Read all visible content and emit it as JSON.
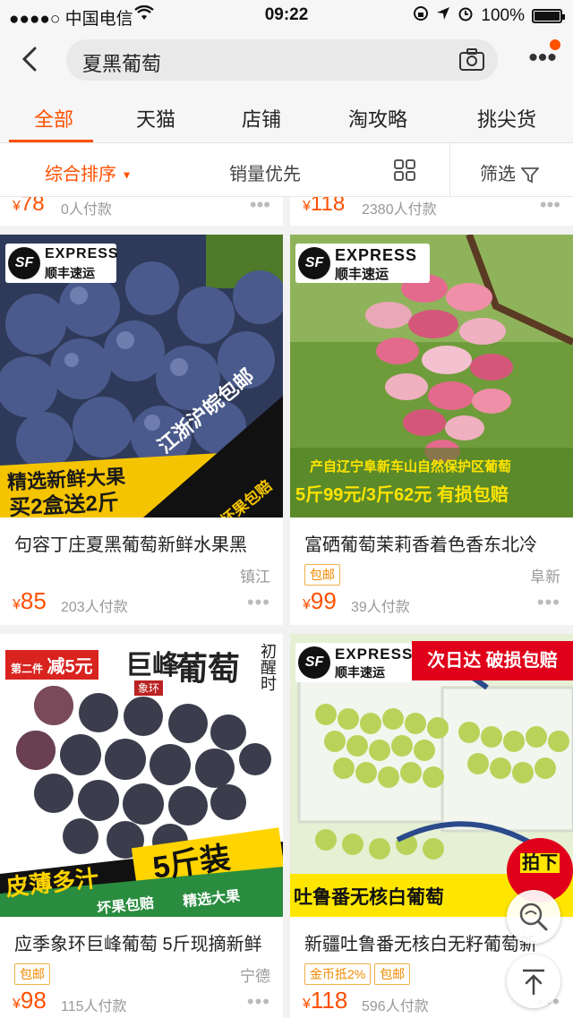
{
  "status": {
    "carrier": "●●●●○ 中国电信",
    "time": "09:22",
    "battery": "100%"
  },
  "search": {
    "query": "夏黑葡萄"
  },
  "tabs": [
    "全部",
    "天猫",
    "店铺",
    "淘攻略",
    "挑尖货"
  ],
  "sort": {
    "comprehensive": "综合排序",
    "sales": "销量优先",
    "filter": "筛选"
  },
  "top_row": [
    {
      "price": "78",
      "paid": "0人付款"
    },
    {
      "price": "118",
      "paid": "2380人付款"
    }
  ],
  "products": [
    {
      "title": "句容丁庄夏黑葡萄新鲜水果黑",
      "location": "镇江",
      "tags": [],
      "price": "85",
      "paid": "203人付款",
      "img_text": {
        "promo1": "精选新鲜大果",
        "promo2": "买2盒送2斤",
        "ribbon": "江浙沪皖包邮",
        "sub": "坏果包赔"
      }
    },
    {
      "title": "富硒葡萄茉莉香着色香东北冷",
      "location": "阜新",
      "tags": [
        "包邮"
      ],
      "price": "99",
      "paid": "39人付款",
      "img_text": {
        "line1": "产自辽宁阜新车山自然保护区葡萄",
        "line2": "5斤99元/3斤62元 有损包赔"
      }
    },
    {
      "title": "应季象环巨峰葡萄 5斤现摘新鲜",
      "location": "宁德",
      "tags": [
        "包邮"
      ],
      "price": "98",
      "paid": "115人付款",
      "img_text": {
        "badge_small": "第二件",
        "badge": "减5元",
        "brand1": "巨峰",
        "brand2": "葡萄",
        "brand3": "象环",
        "side": "初醒时",
        "bottom1": "皮薄多汁",
        "bottom2": "5斤装",
        "bottom3": "坏果包赔",
        "bottom4": "精选大果"
      }
    },
    {
      "title": "新疆吐鲁番无核白无籽葡萄新",
      "location": "",
      "tags": [
        "金币抵2%",
        "包邮"
      ],
      "price": "118",
      "paid": "596人付款",
      "img_text": {
        "banner": "次日达  破损包赔",
        "bottom": "吐鲁番无核白葡萄",
        "badge": "拍下"
      }
    }
  ],
  "sf_logo": {
    "mark": "SF",
    "en": "EXPRESS",
    "cn": "顺丰速运"
  },
  "colors": {
    "accent": "#ff5000",
    "tag": "#f08a00"
  }
}
